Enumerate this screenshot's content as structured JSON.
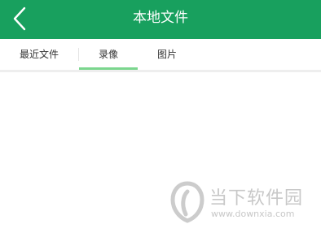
{
  "header": {
    "title": "本地文件",
    "back_icon": "chevron-left-icon",
    "background_color": "#18a05e"
  },
  "tabs": [
    {
      "label": "最近文件",
      "selected": false
    },
    {
      "label": "录像",
      "selected": true
    },
    {
      "label": "图片",
      "selected": false
    }
  ],
  "accent": {
    "indicator_color": "#7bd68e"
  },
  "watermark": {
    "name": "当下软件园",
    "url": "www.downxia.com"
  }
}
